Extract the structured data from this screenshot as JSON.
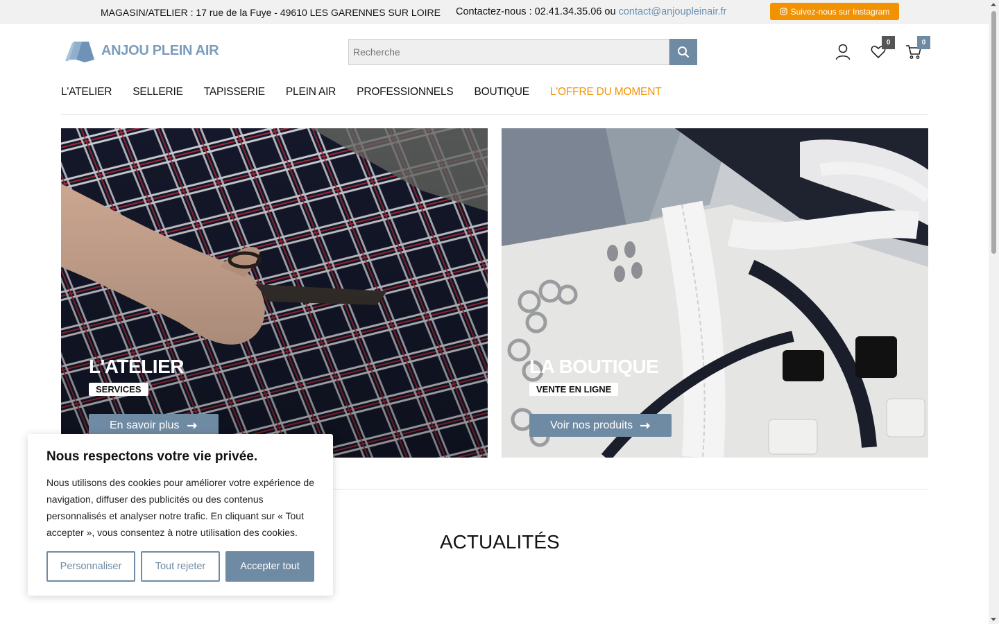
{
  "topbar": {
    "address": "MAGASIN/ATELIER : 17 rue de la Fuye - 49610 LES GARENNES SUR LOIRE",
    "contact_prefix": "Contactez-nous : 02.41.34.35.06 ou ",
    "contact_email": "contact@anjoupleinair.fr",
    "instagram_label": "Suivez-nous sur Instagram"
  },
  "header": {
    "logo_text": "ANJOU PLEIN AIR",
    "search_placeholder": "Recherche",
    "wishlist_count": "0",
    "cart_count": "0"
  },
  "nav": {
    "items": [
      "L'ATELIER",
      "SELLERIE",
      "TAPISSERIE",
      "PLEIN AIR",
      "PROFESSIONNELS",
      "BOUTIQUE"
    ],
    "offer": "L'OFFRE DU MOMENT"
  },
  "panels": {
    "left": {
      "title": "L'ATELIER",
      "tag": "SERVICES",
      "button": "En savoir plus"
    },
    "right": {
      "title": "LA BOUTIQUE",
      "tag": "VENTE EN LIGNE",
      "button": "Voir nos produits"
    }
  },
  "news": {
    "title": "ACTUALITÉS"
  },
  "cookie": {
    "title": "Nous respectons votre vie privée.",
    "text": "Nous utilisons des cookies pour améliorer votre expérience de navigation, diffuser des publicités ou des contenus personnalisés et analyser notre trafic. En cliquant sur « Tout accepter », vous consentez à notre utilisation des cookies.",
    "customize": "Personnaliser",
    "reject": "Tout rejeter",
    "accept": "Accepter tout"
  },
  "colors": {
    "accent": "#6f8aa3",
    "orange": "#f39200",
    "logo": "#7b9dbd"
  },
  "icons": {
    "instagram": "instagram-icon",
    "search": "search-icon",
    "account": "user-icon",
    "wishlist": "heart-icon",
    "cart": "cart-icon",
    "arrow": "arrow-right-icon"
  }
}
